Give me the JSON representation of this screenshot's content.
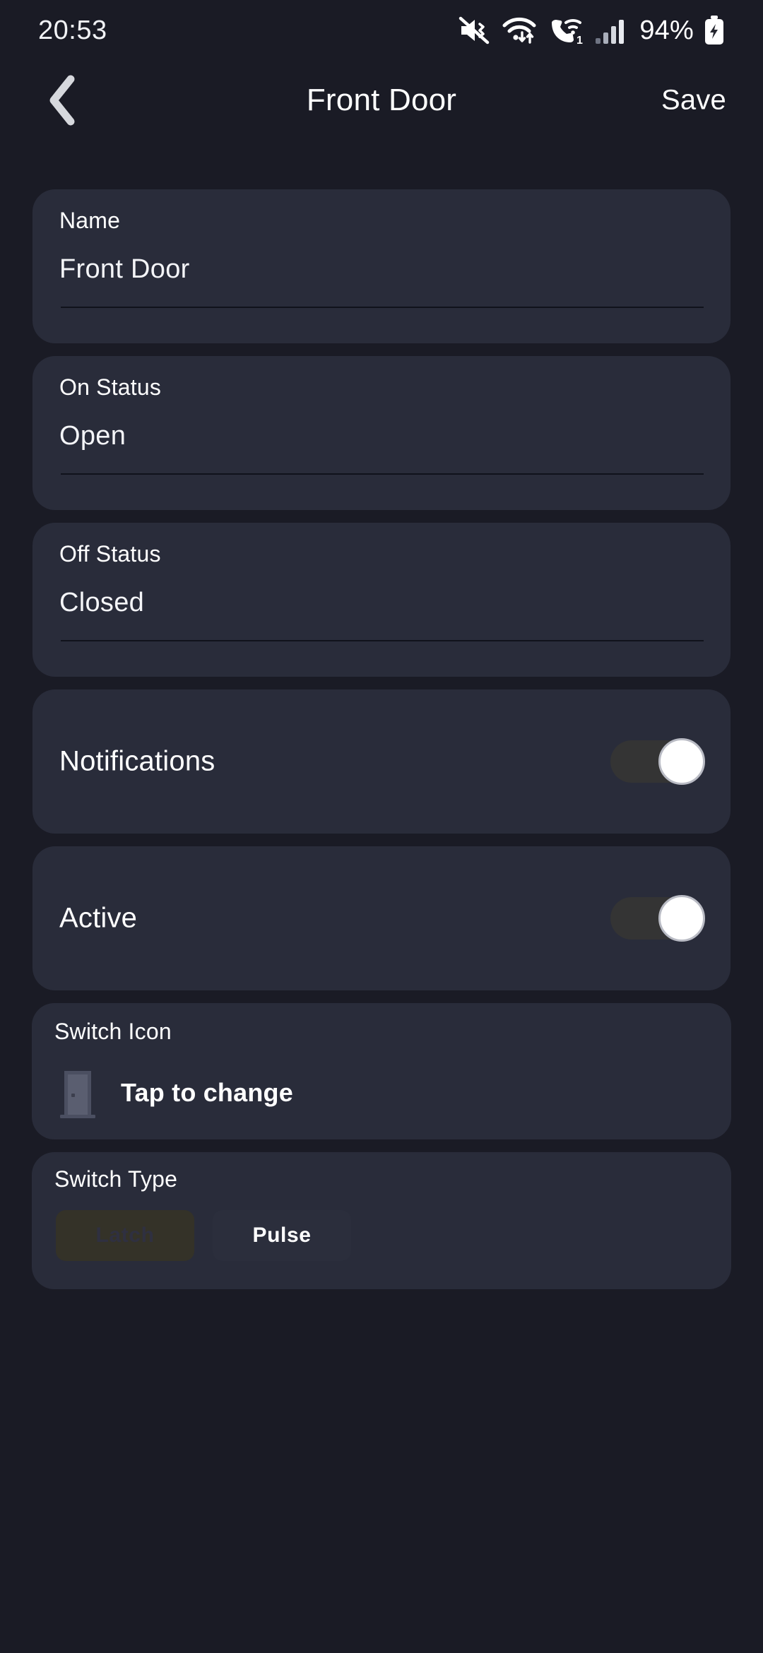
{
  "status_bar": {
    "time": "20:53",
    "battery_percent": "94%",
    "icons": [
      "mute-vibrate-icon",
      "wifi-data-icon",
      "wifi-calling-icon",
      "cellular-signal-icon",
      "battery-charging-icon"
    ]
  },
  "header": {
    "back_icon": "chevron-left-icon",
    "title": "Front Door",
    "save_label": "Save"
  },
  "fields": [
    {
      "label": "Name",
      "value": "Front Door"
    },
    {
      "label": "On Status",
      "value": "Open"
    },
    {
      "label": "Off Status",
      "value": "Closed"
    }
  ],
  "toggles": [
    {
      "label": "Notifications",
      "state": "on"
    },
    {
      "label": "Active",
      "state": "on"
    }
  ],
  "switch_icon": {
    "label": "Switch Icon",
    "icon": "door-icon",
    "hint": "Tap to change"
  },
  "switch_type": {
    "label": "Switch Type",
    "options": [
      {
        "label": "Latch",
        "selected": false,
        "disabled": true
      },
      {
        "label": "Pulse",
        "selected": true,
        "disabled": false
      }
    ]
  },
  "colors": {
    "page_background": "#1a1b25",
    "card_background": "#292c3a",
    "text_primary": "#ffffff",
    "toggle_track": "#343434",
    "toggle_thumb": "#ffffff",
    "latch_background": "#343228",
    "door_icon": "#5a5e70"
  }
}
